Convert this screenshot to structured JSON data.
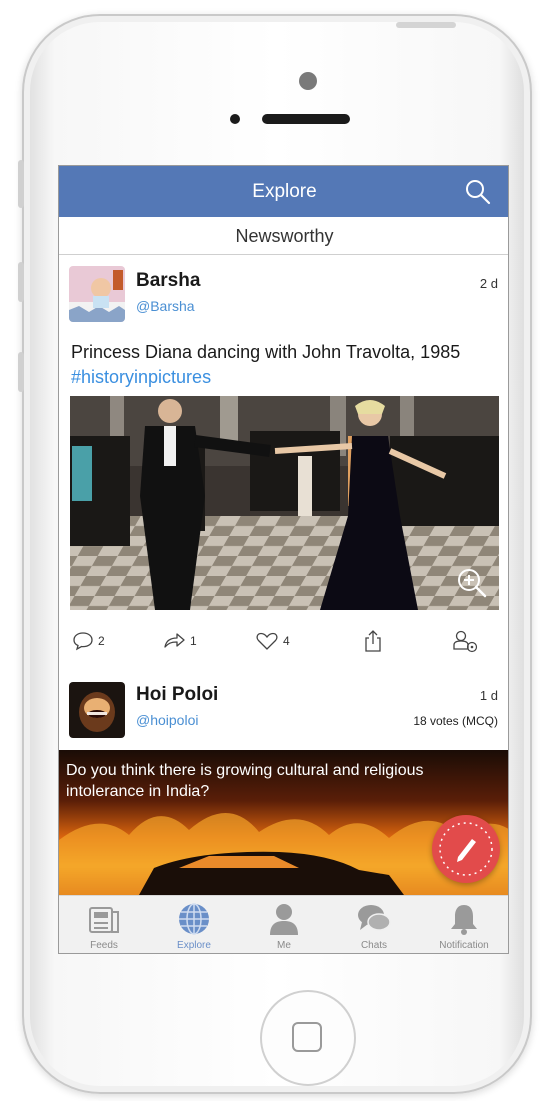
{
  "header": {
    "title": "Explore",
    "subtab": "Newsworthy"
  },
  "posts": [
    {
      "user": "Barsha",
      "handle": "@Barsha",
      "time": "2 d",
      "text": "Princess Diana dancing with John Travolta, 1985 ",
      "hashtag": "#historyinpictures",
      "actions": {
        "comments": "2",
        "reposts": "1",
        "likes": "4"
      }
    },
    {
      "user": "Hoi Poloi",
      "handle": "@hoipoloi",
      "time": "1 d",
      "votes": "18 votes (MCQ)",
      "question": "Do you think there is growing cultural and religious intolerance in India?"
    }
  ],
  "tabbar": [
    {
      "label": "Feeds",
      "icon": "feeds-icon"
    },
    {
      "label": "Explore",
      "icon": "globe-icon",
      "active": true
    },
    {
      "label": "Me",
      "icon": "person-icon"
    },
    {
      "label": "Chats",
      "icon": "chat-icon"
    },
    {
      "label": "Notification",
      "icon": "bell-icon"
    }
  ],
  "colors": {
    "navbar": "#5478b6",
    "hashtag": "#3a8fe0",
    "handle": "#4a8fd3",
    "fab": "#e24b4b"
  }
}
